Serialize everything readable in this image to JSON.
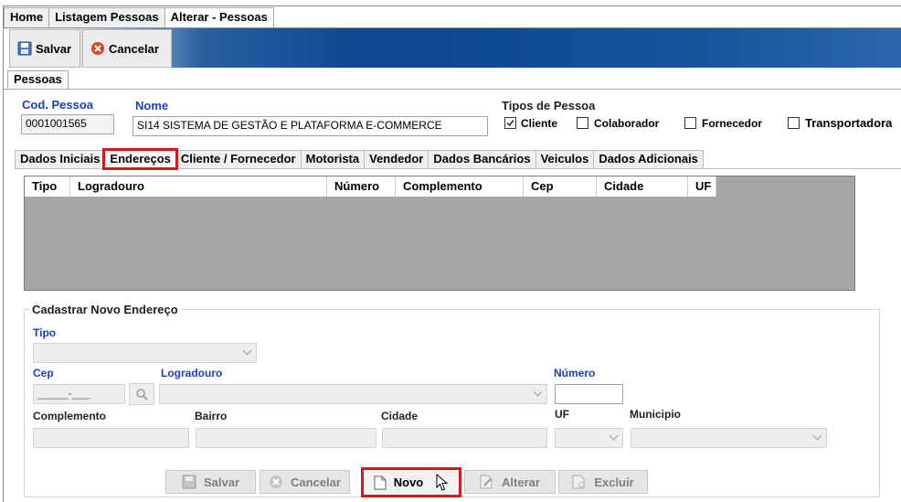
{
  "top_tabs": [
    {
      "label": "Home"
    },
    {
      "label": "Listagem Pessoas"
    },
    {
      "label": "Alterar - Pessoas"
    }
  ],
  "toolbar": {
    "save_label": "Salvar",
    "cancel_label": "Cancelar"
  },
  "section_tab": "Pessoas",
  "pessoa": {
    "cod_label": "Cod. Pessoa",
    "cod_value": "0001001565",
    "nome_label": "Nome",
    "nome_value": "SI14 SISTEMA DE GESTÃO E PLATAFORMA E-COMMERCE"
  },
  "tipos": {
    "title": "Tipos de Pessoa",
    "items": [
      {
        "label": "Cliente",
        "checked": true
      },
      {
        "label": "Colaborador",
        "checked": false
      },
      {
        "label": "Fornecedor",
        "checked": false
      },
      {
        "label": "Transportadora",
        "checked": false
      }
    ]
  },
  "inner_tabs": [
    {
      "label": "Dados Iniciais"
    },
    {
      "label": "Endereços"
    },
    {
      "label": "Cliente / Fornecedor"
    },
    {
      "label": "Motorista"
    },
    {
      "label": "Vendedor"
    },
    {
      "label": "Dados Bancários"
    },
    {
      "label": "Veiculos"
    },
    {
      "label": "Dados Adicionais"
    }
  ],
  "grid_columns": [
    "Tipo",
    "Logradouro",
    "Número",
    "Complemento",
    "Cep",
    "Cidade",
    "UF"
  ],
  "form": {
    "title": "Cadastrar Novo Endereço",
    "tipo_label": "Tipo",
    "cep_label": "Cep",
    "cep_mask": "_____-___",
    "logradouro_label": "Logradouro",
    "numero_label": "Número",
    "complemento_label": "Complemento",
    "bairro_label": "Bairro",
    "cidade_label": "Cidade",
    "uf_label": "UF",
    "municipio_label": "Municipio"
  },
  "buttons": {
    "salvar": "Salvar",
    "cancelar": "Cancelar",
    "novo": "Novo",
    "alterar": "Alterar",
    "excluir": "Excluir"
  },
  "colors": {
    "accent_blue": "#1a3fbf",
    "highlight_red": "#d4191a",
    "toolbar_blue": "#0f4691"
  }
}
